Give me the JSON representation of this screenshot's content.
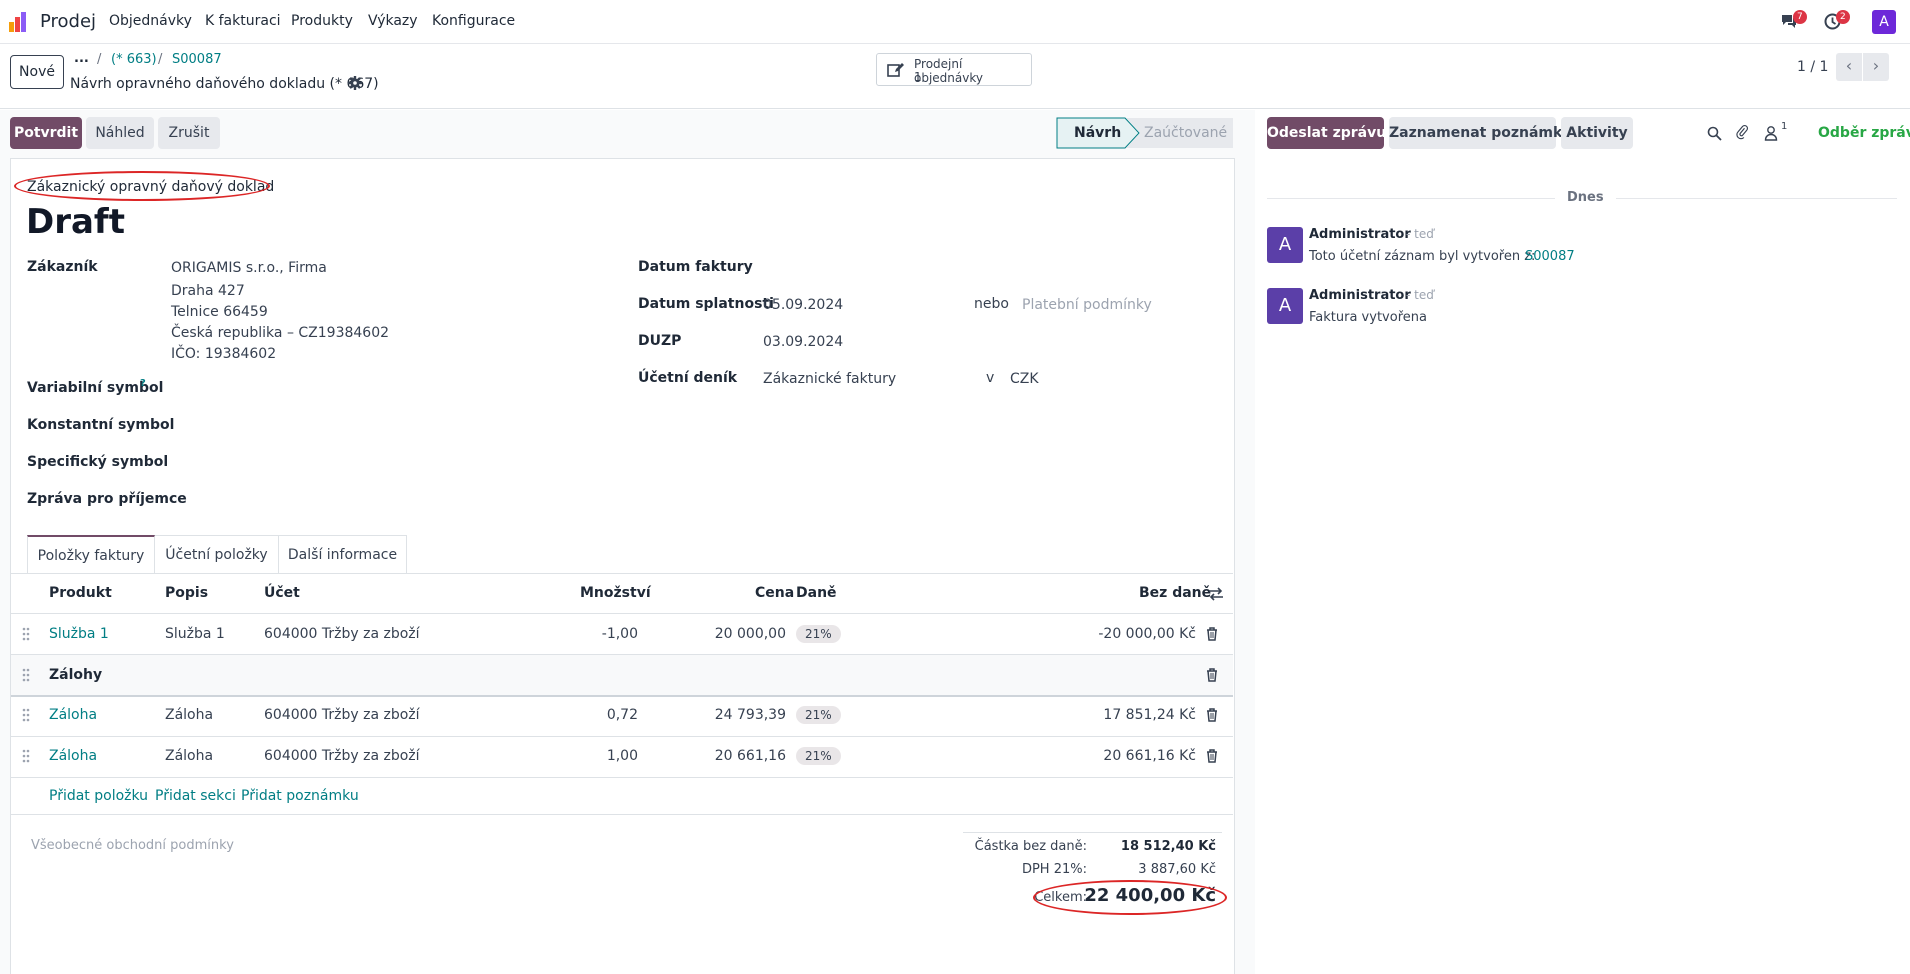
{
  "navbar": {
    "app_name": "Prodej",
    "menu": [
      "Objednávky",
      "K fakturaci",
      "Produkty",
      "Výkazy",
      "Konfigurace"
    ],
    "chat_badge": "7",
    "activity_badge": "2",
    "user_initial": "A"
  },
  "control": {
    "new_button": "Nové",
    "breadcrumb_ellipsis": "...",
    "breadcrumb_1": "(* 663)",
    "breadcrumb_2": "S00087",
    "record_title": "Návrh opravného daňového dokladu (* 667)",
    "smart_button_label": "Prodejní objednávky",
    "smart_button_count": "1",
    "pager": "1 / 1"
  },
  "actions": {
    "confirm": "Potvrdit",
    "preview": "Náhled",
    "cancel": "Zrušit",
    "status_draft": "Návrh",
    "status_posted": "Zaúčtované"
  },
  "form": {
    "doc_type": "Zákaznický opravný daňový doklad",
    "title": "Draft",
    "customer_label": "Zákazník",
    "customer_lines": [
      "ORIGAMIS s.r.o., Firma",
      "Draha 427",
      "Telnice 66459",
      "Česká republika – CZ19384602",
      "IČO: 19384602"
    ],
    "variable_symbol_label": "Variabilní symbol",
    "help_mark": "?",
    "constant_symbol_label": "Konstantní symbol",
    "specific_symbol_label": "Specifický symbol",
    "message_label": "Zpráva pro příjemce",
    "invoice_date_label": "Datum faktury",
    "due_date_label": "Datum splatnosti",
    "due_date_value": "05.09.2024",
    "or_text": "nebo",
    "payment_terms_placeholder": "Platební podmínky",
    "duzp_label": "DUZP",
    "duzp_value": "03.09.2024",
    "journal_label": "Účetní deník",
    "journal_value": "Zákaznické faktury",
    "in_text": "v",
    "currency": "CZK"
  },
  "tabs": [
    "Položky faktury",
    "Účetní položky",
    "Další informace"
  ],
  "table": {
    "headers": [
      "Produkt",
      "Popis",
      "Účet",
      "Množství",
      "Cena",
      "Daně",
      "Bez daně"
    ],
    "rows": [
      {
        "product": "Služba 1",
        "description": "Služba 1",
        "account": "604000 Tržby za zboží",
        "qty": "-1,00",
        "price": "20 000,00",
        "tax": "21%",
        "subtotal": "-20 000,00 Kč"
      },
      {
        "product": "Záloha",
        "description": "Záloha",
        "account": "604000 Tržby za zboží",
        "qty": "0,72",
        "price": "24 793,39",
        "tax": "21%",
        "subtotal": "17 851,24 Kč"
      },
      {
        "product": "Záloha",
        "description": "Záloha",
        "account": "604000 Tržby za zboží",
        "qty": "1,00",
        "price": "20 661,16",
        "tax": "21%",
        "subtotal": "20 661,16 Kč"
      }
    ],
    "section_label": "Zálohy",
    "add_line": "Přidat položku",
    "add_section": "Přidat sekci",
    "add_note": "Přidat poznámku"
  },
  "totals": {
    "terms_placeholder": "Všeobecné obchodní podmínky",
    "untaxed_label": "Částka bez daně:",
    "untaxed_value": "18 512,40 Kč",
    "vat_label": "DPH 21%:",
    "vat_value": "3 887,60 Kč",
    "total_label": "Celkem:",
    "total_value": "22 400,00 Kč"
  },
  "chatter": {
    "send_message": "Odeslat zprávu",
    "log_note": "Zaznamenat poznámku",
    "activities": "Aktivity",
    "follower_count": "1",
    "follow": "Odběr zpráv",
    "date_separator": "Dnes",
    "messages": [
      {
        "avatar": "A",
        "author": "Administrator",
        "time": "- teď",
        "text": "Toto účetní záznam byl vytvořen z:",
        "link": "S00087"
      },
      {
        "avatar": "A",
        "author": "Administrator",
        "time": "- teď",
        "text": "Faktura vytvořena",
        "link": ""
      }
    ]
  },
  "colors": {
    "brand": "#714b67",
    "link": "#017e84",
    "annotation": "#dc2626",
    "follow": "#28a745"
  }
}
